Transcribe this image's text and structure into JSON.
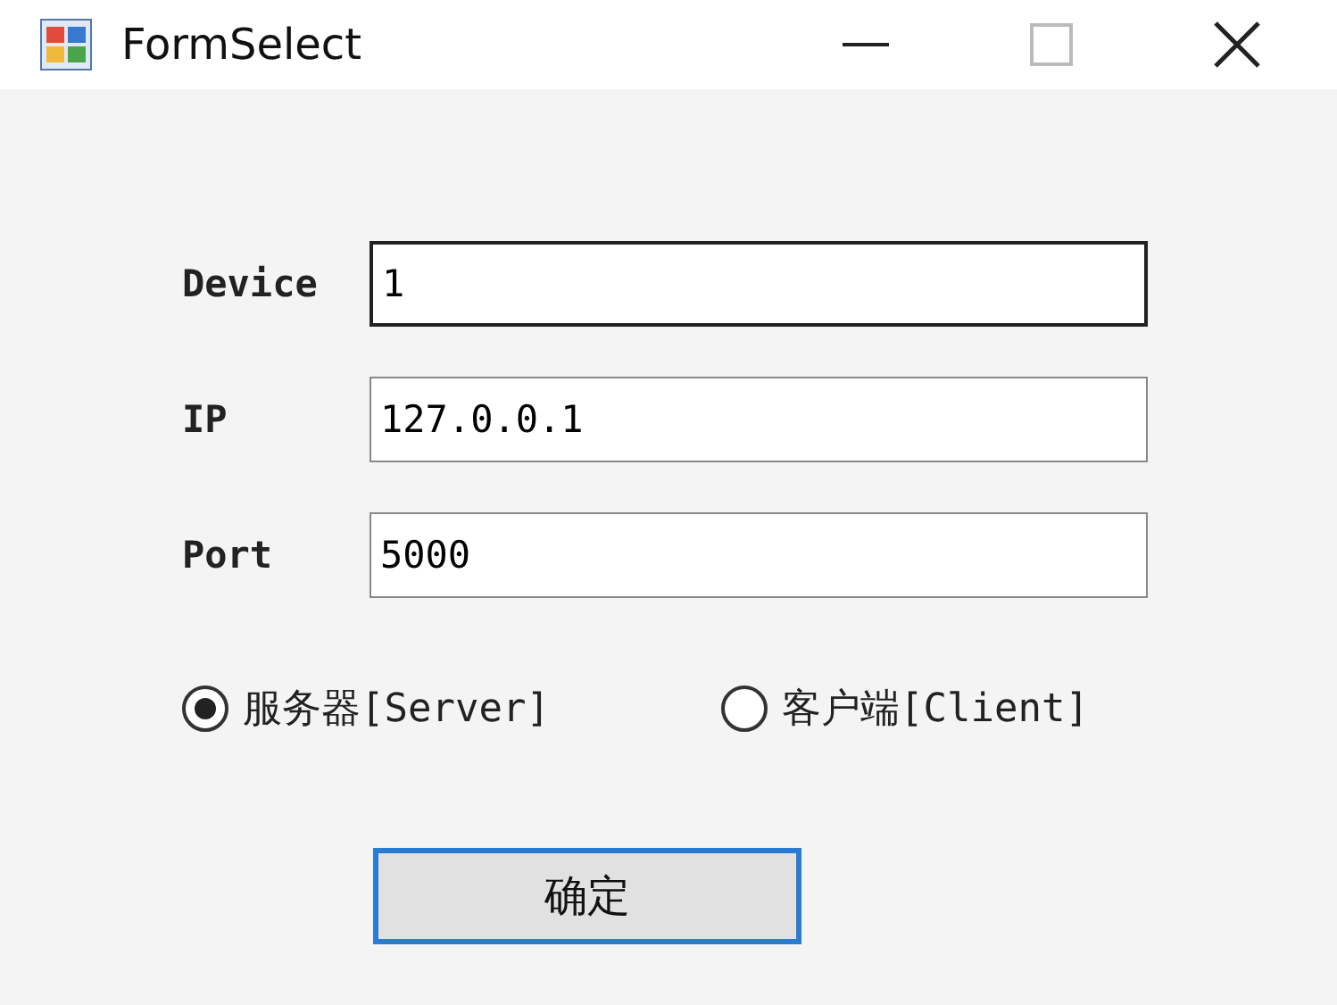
{
  "window": {
    "title": "FormSelect"
  },
  "fields": [
    {
      "label": "Device",
      "value": "1",
      "focused": true
    },
    {
      "label": "IP",
      "value": "127.0.0.1",
      "focused": false
    },
    {
      "label": "Port",
      "value": "5000",
      "focused": false
    }
  ],
  "mode": [
    {
      "label": "服务器[Server]",
      "selected": true
    },
    {
      "label": "客户端[Client]",
      "selected": false
    }
  ],
  "buttons": [
    {
      "label": "确定",
      "focused": true
    }
  ]
}
